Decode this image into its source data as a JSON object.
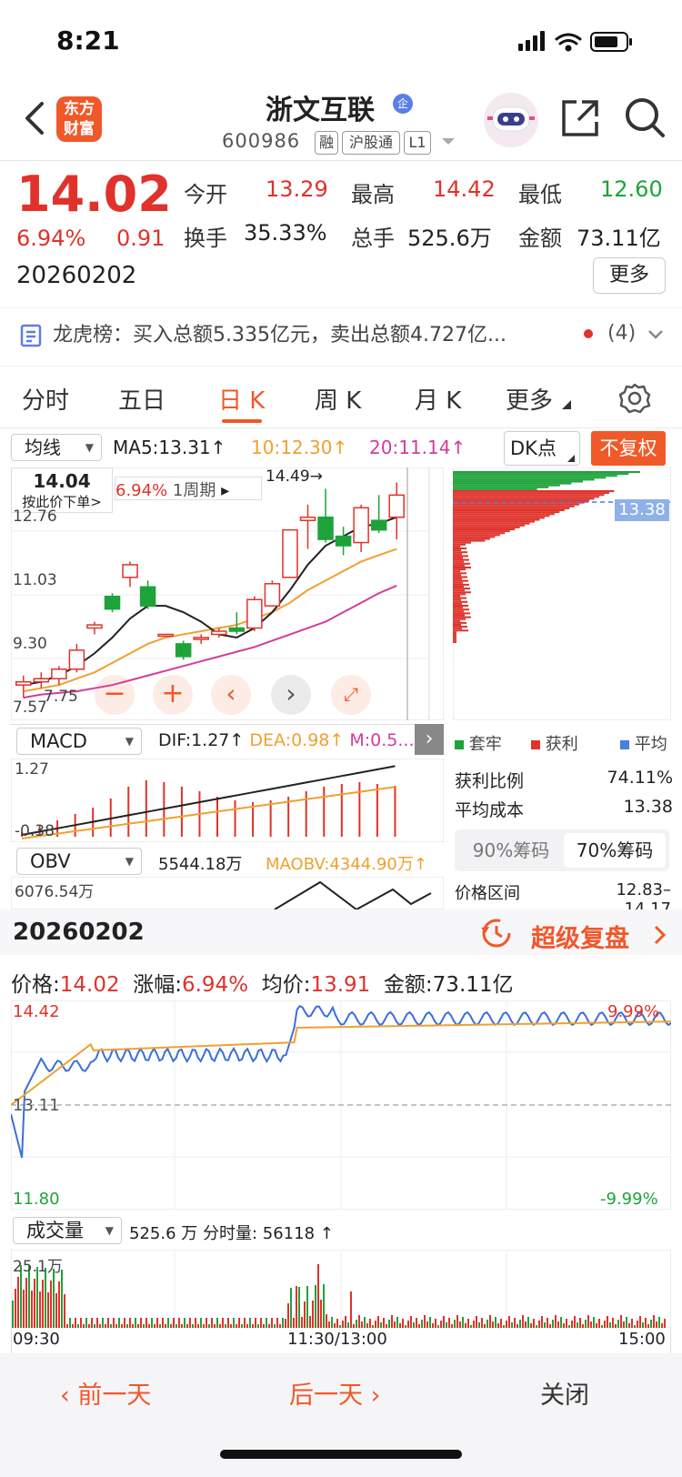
{
  "status": {
    "time": "8:21"
  },
  "nav": {
    "title": "浙文互联",
    "qi_badge": "企",
    "code": "600986",
    "tags": [
      "融",
      "沪股通",
      "L1"
    ],
    "logo": "东方财富"
  },
  "quote": {
    "price": "14.02",
    "change_pct": "6.94%",
    "change": "0.91",
    "date": "20260202",
    "open_label": "今开",
    "open": "13.29",
    "high_label": "最高",
    "high": "14.42",
    "low_label": "最低",
    "low": "12.60",
    "turnover_label": "换手",
    "turnover": "35.33%",
    "vol_label": "总手",
    "vol": "525.6万",
    "amt_label": "金额",
    "amt": "73.11亿",
    "more": "更多"
  },
  "dragon": {
    "label": "龙虎榜：",
    "text": "买入总额5.335亿元，卖出总额4.727亿...",
    "count": "(4)"
  },
  "tabs": [
    "分时",
    "五日",
    "日 K",
    "周 K",
    "月 K",
    "更多"
  ],
  "kline": {
    "ma_select": "均线",
    "ma5": "MA5:13.31",
    "ma10": "10:12.30",
    "ma20": "20:11.14",
    "dk": "DK点",
    "fq": "不复权",
    "tip_price": "14.04",
    "tip_text": "按此价下单>",
    "tip_pct": "6.94%",
    "tip_period": "1周期",
    "high_mark": "14.49→",
    "y_labels": [
      "12.76",
      "11.03",
      "9.30",
      "7.57"
    ],
    "low_mark": "7.75",
    "cost_tag": "13.38",
    "candles": [
      [
        8.0,
        8.3,
        7.6,
        8.1
      ],
      [
        8.1,
        8.4,
        7.9,
        8.2
      ],
      [
        8.2,
        8.6,
        8.0,
        8.5
      ],
      [
        8.5,
        9.3,
        8.4,
        9.1
      ],
      [
        9.8,
        10.0,
        9.6,
        9.9
      ],
      [
        10.8,
        10.9,
        10.3,
        10.4
      ],
      [
        11.4,
        11.9,
        11.1,
        11.8
      ],
      [
        11.1,
        11.3,
        10.4,
        10.5
      ],
      [
        9.6,
        9.6,
        9.6,
        9.6
      ],
      [
        9.3,
        9.4,
        8.8,
        8.9
      ],
      [
        9.5,
        9.6,
        9.3,
        9.5
      ],
      [
        9.6,
        9.8,
        9.5,
        9.7
      ],
      [
        9.8,
        10.3,
        9.6,
        9.7
      ],
      [
        9.8,
        10.8,
        9.7,
        10.7
      ],
      [
        10.5,
        11.3,
        10.5,
        11.2
      ],
      [
        11.4,
        12.9,
        11.4,
        12.9
      ],
      [
        13.2,
        13.7,
        12.3,
        13.3
      ],
      [
        13.3,
        14.2,
        12.5,
        12.6
      ],
      [
        12.7,
        13.0,
        12.1,
        12.4
      ],
      [
        12.5,
        13.7,
        12.2,
        13.6
      ],
      [
        13.2,
        14.0,
        12.8,
        12.9
      ],
      [
        13.3,
        14.4,
        12.6,
        14.0
      ]
    ],
    "ma5_line": [
      8.0,
      8.1,
      8.3,
      8.6,
      9.0,
      9.5,
      10.1,
      10.5,
      10.5,
      10.3,
      10.0,
      9.6,
      9.5,
      9.8,
      10.3,
      11.0,
      11.8,
      12.4,
      12.7,
      13.0,
      13.1,
      13.3
    ],
    "ma10_line": [
      7.8,
      7.9,
      8.0,
      8.2,
      8.4,
      8.7,
      9.0,
      9.3,
      9.5,
      9.6,
      9.7,
      9.8,
      9.9,
      10.1,
      10.3,
      10.6,
      11.0,
      11.3,
      11.6,
      11.9,
      12.1,
      12.3
    ],
    "ma20_line": [
      7.6,
      7.7,
      7.75,
      7.8,
      7.9,
      8.0,
      8.15,
      8.3,
      8.45,
      8.6,
      8.75,
      8.9,
      9.05,
      9.2,
      9.4,
      9.6,
      9.8,
      10.0,
      10.3,
      10.6,
      10.9,
      11.14
    ]
  },
  "macd": {
    "select": "MACD",
    "dif": "DIF:1.27",
    "dea": "DEA:0.98",
    "m": "M:0.5...",
    "y_top": "1.27",
    "y_bot": "-0.38",
    "bars": [
      0.05,
      0.12,
      0.18,
      0.25,
      0.32,
      0.42,
      0.55,
      0.62,
      0.6,
      0.55,
      0.5,
      0.44,
      0.4,
      0.38,
      0.4,
      0.44,
      0.5,
      0.55,
      0.58,
      0.6,
      0.58,
      0.56
    ]
  },
  "obv": {
    "select": "OBV",
    "val": "5544.18万",
    "maobv": "MAOBV:4344.90万",
    "y_top": "6076.54万"
  },
  "chip": {
    "legend": [
      "套牢",
      "获利",
      "平均"
    ],
    "profit_label": "获利比例",
    "profit": "74.11%",
    "cost_label": "平均成本",
    "cost": "13.38",
    "tab90": "90%筹码",
    "tab70": "70%筹码",
    "range_label": "价格区间",
    "range": "12.83–14.17"
  },
  "intraday": {
    "date": "20260202",
    "replay": "超级复盘",
    "price_label": "价格:",
    "price": "14.02",
    "pct_label": "涨幅:",
    "pct": "6.94%",
    "avg_label": "均价:",
    "avg": "13.91",
    "amt_label": "金额:",
    "amt": "73.11亿",
    "y_top": "14.42",
    "y_mid": "13.11",
    "y_bot": "11.80",
    "pct_top": "9.99%",
    "pct_bot": "-9.99%",
    "vol_select": "成交量",
    "vol_text": "525.6 万 分时量: 56118",
    "vol_top": "25.1万",
    "x_labels": [
      "09:30",
      "11:30/13:00",
      "15:00"
    ]
  },
  "footer": {
    "prev": "前一天",
    "next": "后一天",
    "close": "关闭"
  },
  "colors": {
    "accent": "#f0582a",
    "up": "#e0322b",
    "down": "#1ea33a"
  }
}
